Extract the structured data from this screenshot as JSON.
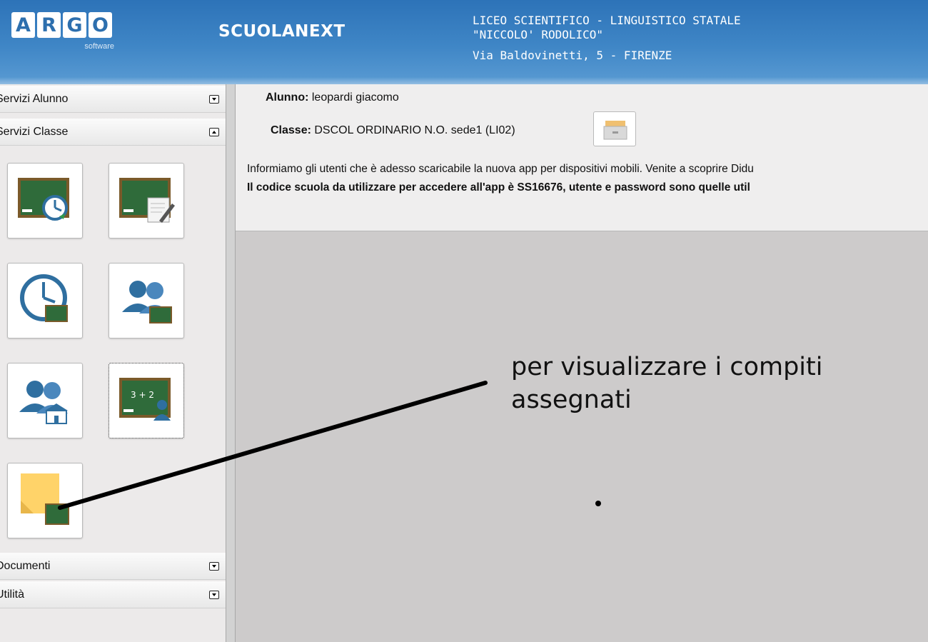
{
  "header": {
    "logo_letters": [
      "A",
      "R",
      "G",
      "O"
    ],
    "logo_sub": "software",
    "product": "SCUOLANEXT",
    "school_line1": "LICEO SCIENTIFICO - LINGUISTICO STATALE",
    "school_line2": "\"NICCOLO' RODOLICO\"",
    "school_line3": "Via Baldovinetti, 5 - FIRENZE"
  },
  "sidebar": {
    "sections": [
      {
        "label": "Servizi Alunno",
        "expanded": false
      },
      {
        "label": "Servizi Classe",
        "expanded": true
      },
      {
        "label": "Documenti",
        "expanded": false
      },
      {
        "label": "Utilità",
        "expanded": false
      }
    ],
    "tiles": [
      {
        "icon": "blackboard-clock-icon"
      },
      {
        "icon": "blackboard-pencil-icon"
      },
      {
        "icon": "clock-blackboard-icon"
      },
      {
        "icon": "people-blackboard-icon"
      },
      {
        "icon": "people-school-icon"
      },
      {
        "icon": "blackboard-math-person-icon",
        "selected": true
      },
      {
        "icon": "sticky-note-blackboard-icon"
      }
    ]
  },
  "content": {
    "student_label": "Alunno:",
    "student_value": "leopardi giacomo",
    "class_label": "Classe:",
    "class_value": "DSCOL ORDINARIO N.O. sede1 (LI02)",
    "notice_line1": "Informiamo gli utenti che è adesso scaricabile la nuova app per dispositivi mobili. Venite a scoprire Didu",
    "notice_line2": "Il codice scuola da utilizzare per accedere all'app è SS16676, utente e password sono quelle util"
  },
  "annotation": {
    "line1": "per visualizzare i compiti",
    "line2": "assegnati"
  },
  "colors": {
    "header_blue": "#3f86c6",
    "blackboard_green": "#2f6b3a",
    "accent_blue": "#2f6fa0"
  }
}
